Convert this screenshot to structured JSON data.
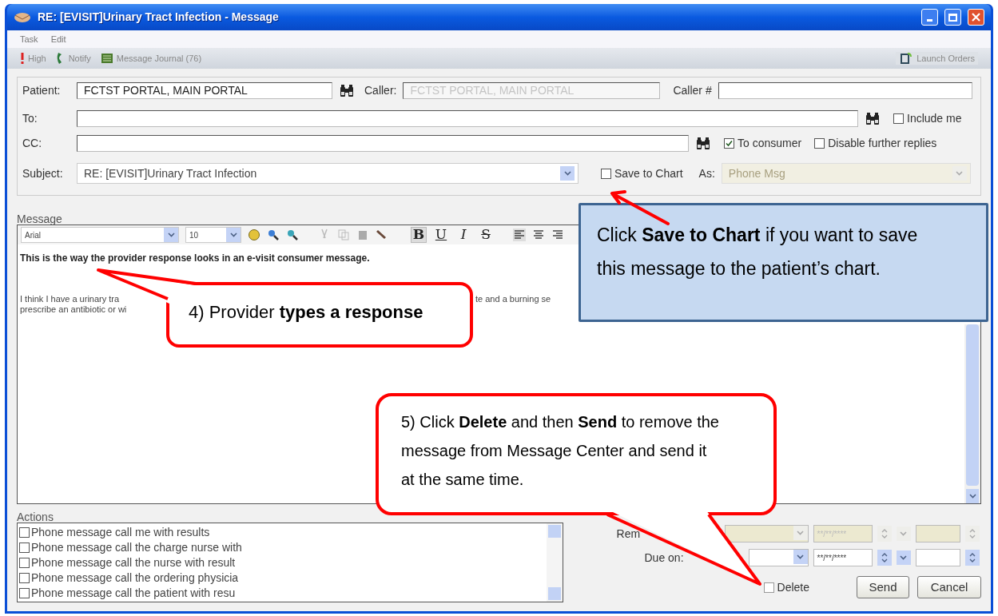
{
  "window": {
    "title": "RE: [EVISIT]Urinary Tract Infection - Message"
  },
  "menu": [
    "Task",
    "Edit"
  ],
  "toolbar": {
    "items": [
      {
        "label": "High",
        "kind": "priority"
      },
      {
        "label": "Notify",
        "kind": "phone"
      },
      {
        "label": "Message Journal (76)",
        "kind": "journal"
      }
    ],
    "launch": "Launch Orders"
  },
  "form": {
    "patient": {
      "label": "Patient:",
      "value": "FCTST PORTAL, MAIN PORTAL"
    },
    "caller": {
      "label": "Caller:",
      "value": "FCTST PORTAL, MAIN PORTAL",
      "disabled": true
    },
    "caller_number": {
      "label": "Caller #"
    },
    "to": {
      "label": "To:"
    },
    "include_me": {
      "label": "Include me",
      "checked": false
    },
    "cc": {
      "label": "CC:"
    },
    "to_consumer": {
      "label": "To consumer",
      "checked": true
    },
    "disable_replies": {
      "label": "Disable further replies",
      "checked": false
    },
    "subject": {
      "label": "Subject:",
      "value": "RE: [EVISIT]Urinary Tract Infection"
    },
    "save_to_chart": {
      "label": "Save to Chart",
      "checked": false
    },
    "as": {
      "label": "As:",
      "value": "Phone Msg",
      "disabled": true
    }
  },
  "message": {
    "label": "Message",
    "font": "Arial",
    "size": "10",
    "format_buttons": [
      {
        "label": "B",
        "selected": true
      },
      {
        "label": "U",
        "selected": false
      },
      {
        "label": "I",
        "selected": false
      },
      {
        "label": "S",
        "selected": false
      }
    ],
    "response": "This is the way the provider response looks in an e-visit consumer message.",
    "body_lines": [
      {
        "fragments": [
          "I think I have a urinary tra",
          "te and a burning se"
        ]
      },
      {
        "fragments": [
          "prescribe an antibiotic or wi"
        ]
      }
    ]
  },
  "actions": {
    "label": "Actions",
    "items": [
      {
        "label": "Phone message call me with results",
        "checked": false
      },
      {
        "label": "Phone message call the charge nurse with",
        "checked": false
      },
      {
        "label": "Phone message call the nurse with result",
        "checked": false
      },
      {
        "label": "Phone message call the ordering physicia",
        "checked": false
      },
      {
        "label": "Phone message call the patient with resu",
        "checked": false
      }
    ]
  },
  "reminder": {
    "label": "Rem",
    "date": "**/**/****",
    "disabled": true
  },
  "due": {
    "label": "Due on:",
    "date": "**/**/****",
    "disabled": false
  },
  "delete": {
    "label": "Delete",
    "checked": false
  },
  "buttons": [
    "Send",
    "Cancel"
  ],
  "callouts": [
    {
      "kind": "bubble",
      "text": "4) Provider **types a response**"
    },
    {
      "kind": "note",
      "text": "Click **Save to Chart** if you want to save this message to the patient’s chart."
    },
    {
      "kind": "bubble",
      "text": "5) Click **Delete** and then **Send** to remove the message from Message Center and send it at the same time."
    }
  ]
}
